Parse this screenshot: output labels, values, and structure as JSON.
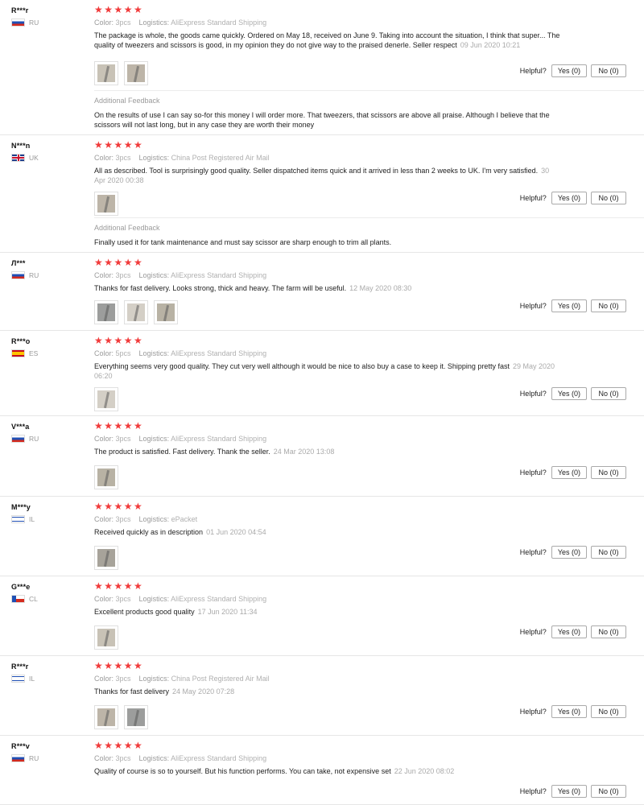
{
  "helpful_label": "Helpful?",
  "stars": "★★★★★",
  "meta_labels": {
    "color": "Color:",
    "logistics": "Logistics:"
  },
  "feedback_title": "Additional Feedback",
  "reviews": [
    {
      "user": "R***r",
      "country": "RU",
      "flag": "ru",
      "color": "3pcs",
      "logistics": "AliExpress Standard Shipping",
      "text": "The package is whole, the goods came quickly. Ordered on May 18, received on June 9. Taking into account the situation, I think that super... The quality of tweezers and scissors is good, in my opinion they do not give way to the praised denerle. Seller respect",
      "date": "09 Jun 2020 10:21",
      "images": 2,
      "yes": "Yes (0)",
      "no": "No (0)",
      "feedback": "On the results of use I can say so-for this money I will order more. That tweezers, that scissors are above all praise. Although I believe that the scissors will not last long, but in any case they are worth their money"
    },
    {
      "user": "N***n",
      "country": "UK",
      "flag": "uk",
      "color": "3pcs",
      "logistics": "China Post Registered Air Mail",
      "text": "All as described. Tool is surprisingly good quality. Seller dispatched items quick and it arrived in less than 2 weeks to UK. I'm very satisfied.",
      "date": "30 Apr 2020 00:38",
      "images": 1,
      "yes": "Yes (0)",
      "no": "No (0)",
      "feedback": "Finally used it for tank maintenance and must say scissor are sharp enough to trim all plants."
    },
    {
      "user": "Л***",
      "country": "RU",
      "flag": "ru",
      "color": "3pcs",
      "logistics": "AliExpress Standard Shipping",
      "text": "Thanks for fast delivery. Looks strong, thick and heavy. The farm will be useful.",
      "date": "12 May 2020 08:30",
      "images": 3,
      "yes": "Yes (0)",
      "no": "No (0)"
    },
    {
      "user": "R***o",
      "country": "ES",
      "flag": "es",
      "color": "5pcs",
      "logistics": "AliExpress Standard Shipping",
      "text": "Everything seems very good quality. They cut very well although it would be nice to also buy a case to keep it. Shipping pretty fast",
      "date": "29 May 2020 06:20",
      "images": 1,
      "yes": "Yes (0)",
      "no": "No (0)"
    },
    {
      "user": "V***a",
      "country": "RU",
      "flag": "ru",
      "color": "3pcs",
      "logistics": "AliExpress Standard Shipping",
      "text": "The product is satisfied. Fast delivery. Thank the seller.",
      "date": "24 Mar 2020 13:08",
      "images": 1,
      "yes": "Yes (0)",
      "no": "No (0)"
    },
    {
      "user": "M***y",
      "country": "IL",
      "flag": "il",
      "color": "3pcs",
      "logistics": "ePacket",
      "text": "Received quickly as in description",
      "date": "01 Jun 2020 04:54",
      "images": 1,
      "yes": "Yes (0)",
      "no": "No (0)"
    },
    {
      "user": "G***e",
      "country": "CL",
      "flag": "cl",
      "color": "3pcs",
      "logistics": "AliExpress Standard Shipping",
      "text": "Excellent products good quality",
      "date": "17 Jun 2020 11:34",
      "images": 1,
      "yes": "Yes (0)",
      "no": "No (0)"
    },
    {
      "user": "R***r",
      "country": "IL",
      "flag": "il",
      "color": "3pcs",
      "logistics": "China Post Registered Air Mail",
      "text": "Thanks for fast delivery",
      "date": "24 May 2020 07:28",
      "images": 2,
      "yes": "Yes (0)",
      "no": "No (0)"
    },
    {
      "user": "R***v",
      "country": "RU",
      "flag": "ru",
      "color": "3pcs",
      "logistics": "AliExpress Standard Shipping",
      "text": "Quality of course is so to yourself. But his function performs. You can take, not expensive set",
      "date": "22 Jun 2020 08:02",
      "images": 0,
      "yes": "Yes (0)",
      "no": "No (0)"
    }
  ]
}
